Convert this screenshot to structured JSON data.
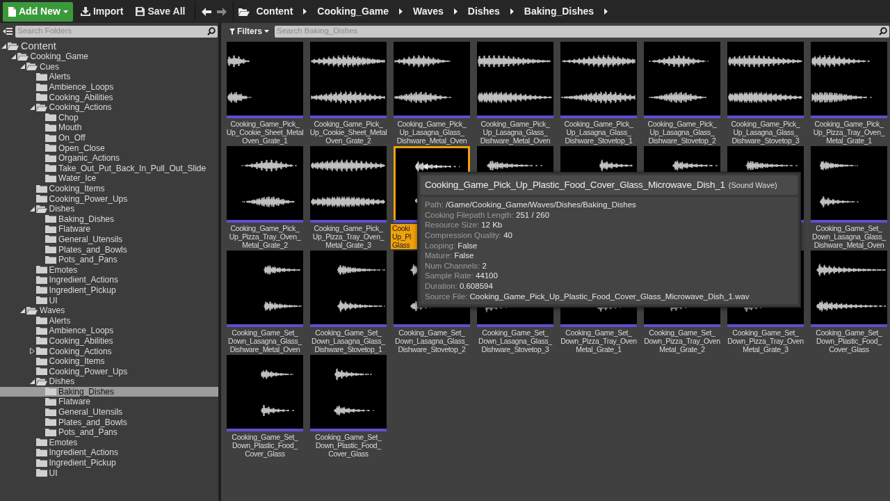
{
  "toolbar": {
    "buttons": [
      {
        "kind": "add",
        "label": "Add New"
      },
      {
        "kind": "import",
        "label": "Import"
      },
      {
        "kind": "save",
        "label": "Save All"
      }
    ],
    "breadcrumbs": [
      "Content",
      "Cooking_Game",
      "Waves",
      "Dishes",
      "Baking_Dishes"
    ]
  },
  "folder_panel": {
    "search": {
      "placeholder": "Search Folders"
    },
    "tree": [
      {
        "label": "Content",
        "expanded": true,
        "selected": false,
        "children": [
          {
            "label": "Cooking_Game",
            "expanded": true,
            "selected": false,
            "children": [
              {
                "label": "Cues",
                "expanded": true,
                "selected": false,
                "children": [
                  {
                    "label": "Alerts",
                    "selected": false
                  },
                  {
                    "label": "Ambience_Loops",
                    "selected": false
                  },
                  {
                    "label": "Cooking_Abilities",
                    "selected": false
                  },
                  {
                    "label": "Cooking_Actions",
                    "expanded": true,
                    "selected": false,
                    "children": [
                      {
                        "label": "Chop",
                        "selected": false
                      },
                      {
                        "label": "Mouth",
                        "selected": false
                      },
                      {
                        "label": "On_Off",
                        "selected": false
                      },
                      {
                        "label": "Open_Close",
                        "selected": false
                      },
                      {
                        "label": "Organic_Actions",
                        "selected": false
                      },
                      {
                        "label": "Take_Out_Put_Back_In_Pull_Out_Slide",
                        "selected": false
                      },
                      {
                        "label": "Water_Ice",
                        "selected": false
                      }
                    ]
                  },
                  {
                    "label": "Cooking_Items",
                    "selected": false
                  },
                  {
                    "label": "Cooking_Power_Ups",
                    "selected": false
                  },
                  {
                    "label": "Dishes",
                    "expanded": true,
                    "selected": false,
                    "children": [
                      {
                        "label": "Baking_Dishes",
                        "selected": false
                      },
                      {
                        "label": "Flatware",
                        "selected": false
                      },
                      {
                        "label": "General_Utensils",
                        "selected": false
                      },
                      {
                        "label": "Plates_and_Bowls",
                        "selected": false
                      },
                      {
                        "label": "Pots_and_Pans",
                        "selected": false
                      }
                    ]
                  },
                  {
                    "label": "Emotes",
                    "selected": false
                  },
                  {
                    "label": "Ingredient_Actions",
                    "selected": false
                  },
                  {
                    "label": "Ingredient_Pickup",
                    "selected": false
                  },
                  {
                    "label": "UI",
                    "selected": false
                  }
                ]
              },
              {
                "label": "Waves",
                "expanded": true,
                "selected": false,
                "children": [
                  {
                    "label": "Alerts",
                    "selected": false
                  },
                  {
                    "label": "Ambience_Loops",
                    "selected": false
                  },
                  {
                    "label": "Cooking_Abilities",
                    "selected": false
                  },
                  {
                    "label": "Cooking_Actions",
                    "expanded": false,
                    "selected": false
                  },
                  {
                    "label": "Cooking_Items",
                    "selected": false
                  },
                  {
                    "label": "Cooking_Power_Ups",
                    "selected": false
                  },
                  {
                    "label": "Dishes",
                    "expanded": true,
                    "selected": false,
                    "children": [
                      {
                        "label": "Baking_Dishes",
                        "selected": true
                      },
                      {
                        "label": "Flatware",
                        "selected": false
                      },
                      {
                        "label": "General_Utensils",
                        "selected": false
                      },
                      {
                        "label": "Plates_and_Bowls",
                        "selected": false
                      },
                      {
                        "label": "Pots_and_Pans",
                        "selected": false
                      }
                    ]
                  },
                  {
                    "label": "Emotes",
                    "selected": false
                  },
                  {
                    "label": "Ingredient_Actions",
                    "selected": false
                  },
                  {
                    "label": "Ingredient_Pickup",
                    "selected": false
                  },
                  {
                    "label": "UI",
                    "selected": false
                  }
                ]
              }
            ]
          }
        ]
      }
    ]
  },
  "asset_panel": {
    "filters": {
      "label": "Filters"
    },
    "search": {
      "placeholder": "Search Baking_Dishes"
    },
    "assets": [
      {
        "label_lines": [
          "Cooking_Game_Pick_",
          "Up_Cookie_Sheet_Metal",
          "Oven_Grate_1"
        ],
        "selected": false
      },
      {
        "label_lines": [
          "Cooking_Game_Pick_",
          "Up_Cookie_Sheet_Metal",
          "Oven_Grate_2"
        ],
        "selected": false
      },
      {
        "label_lines": [
          "Cooking_Game_Pick_",
          "Up_Lasagna_Glass_",
          "Dishware_Metal_Oven"
        ],
        "selected": false
      },
      {
        "label_lines": [
          "Cooking_Game_Pick_",
          "Up_Lasagna_Glass_",
          "Dishware_Metal_Oven"
        ],
        "selected": false
      },
      {
        "label_lines": [
          "Cooking_Game_Pick_",
          "Up_Lasagna_Glass_",
          "Dishware_Stovetop_1"
        ],
        "selected": false
      },
      {
        "label_lines": [
          "Cooking_Game_Pick_",
          "Up_Lasagna_Glass_",
          "Dishware_Stovetop_2"
        ],
        "selected": false
      },
      {
        "label_lines": [
          "Cooking_Game_Pick_",
          "Up_Lasagna_Glass_",
          "Dishware_Stovetop_3"
        ],
        "selected": false
      },
      {
        "label_lines": [
          "Cooking_Game_Pick_",
          "Up_Pizza_Tray_Oven_",
          "Metal_Grate_1"
        ],
        "selected": false
      },
      {
        "label_lines": [
          "Cooking_Game_Pick_",
          "Up_Pizza_Tray_Oven_",
          "Metal_Grate_2"
        ],
        "selected": false
      },
      {
        "label_lines": [
          "Cooking_Game_Pick_",
          "Up_Pizza_Tray_Oven_",
          "Metal_Grate_3"
        ],
        "selected": false
      },
      {
        "label_lines": [
          "Cooki",
          "Up_Pl",
          "Glass"
        ],
        "selected": true
      },
      {
        "selected": false
      },
      {
        "selected": false
      },
      {
        "selected": false
      },
      {
        "selected": false
      },
      {
        "label_lines": [
          "Cooking_Game_Set_",
          "Down_Lasagna_Glass_",
          "Dishware_Metal_Oven"
        ],
        "selected": false
      },
      {
        "label_lines": [
          "Cooking_Game_Set_",
          "Down_Lasagna_Glass_",
          "Dishware_Metal_Oven"
        ],
        "selected": false
      },
      {
        "label_lines": [
          "Cooking_Game_Set_",
          "Down_Lasagna_Glass_",
          "Dishware_Stovetop_1"
        ],
        "selected": false
      },
      {
        "label_lines": [
          "Cooking_Game_Set_",
          "Down_Lasagna_Glass_",
          "Dishware_Stovetop_2"
        ],
        "selected": false
      },
      {
        "label_lines": [
          "Cooking_Game_Set_",
          "Down_Lasagna_Glass_",
          "Dishware_Stovetop_3"
        ],
        "selected": false
      },
      {
        "label_lines": [
          "Cooking_Game_Set_",
          "Down_Pizza_Tray_Oven",
          "Metal_Grate_1"
        ],
        "selected": false
      },
      {
        "label_lines": [
          "Cooking_Game_Set_",
          "Down_Pizza_Tray_Oven",
          "Metal_Grate_2"
        ],
        "selected": false
      },
      {
        "label_lines": [
          "Cooking_Game_Set_",
          "Down_Pizza_Tray_Oven",
          "Metal_Grate_3"
        ],
        "selected": false
      },
      {
        "label_lines": [
          "Cooking_Game_Set_",
          "Down_Plastic_Food_",
          "Cover_Glass"
        ],
        "selected": false
      },
      {
        "label_lines": [
          "Cooking_Game_Set_",
          "Down_Plastic_Food_",
          "Cover_Glass"
        ],
        "selected": false
      },
      {
        "label_lines": [
          "Cooking_Game_Set_",
          "Down_Plastic_Food_",
          "Cover_Glass"
        ],
        "selected": false
      }
    ],
    "tooltip": {
      "title": "Cooking_Game_Pick_Up_Plastic_Food_Cover_Glass_Microwave_Dish_1",
      "type": "(Sound Wave)",
      "properties": [
        {
          "name": "Path:",
          "value": "/Game/Cooking_Game/Waves/Dishes/Baking_Dishes"
        },
        {
          "name": "Cooking Filepath Length:",
          "value": "251 / 260"
        },
        {
          "name": "Resource Size:",
          "value": "12 Kb"
        },
        {
          "name": "Compression Quality:",
          "value": "40"
        },
        {
          "name": "Looping:",
          "value": "False"
        },
        {
          "name": "Mature:",
          "value": "False"
        },
        {
          "name": "Num Channels:",
          "value": "2"
        },
        {
          "name": "Sample Rate:",
          "value": "44100"
        },
        {
          "name": "Duration:",
          "value": "0.608594"
        },
        {
          "name": "Source File:",
          "value": "Cooking_Game_Pick_Up_Plastic_Food_Cover_Glass_Microwave_Dish_1.wav"
        }
      ]
    }
  }
}
